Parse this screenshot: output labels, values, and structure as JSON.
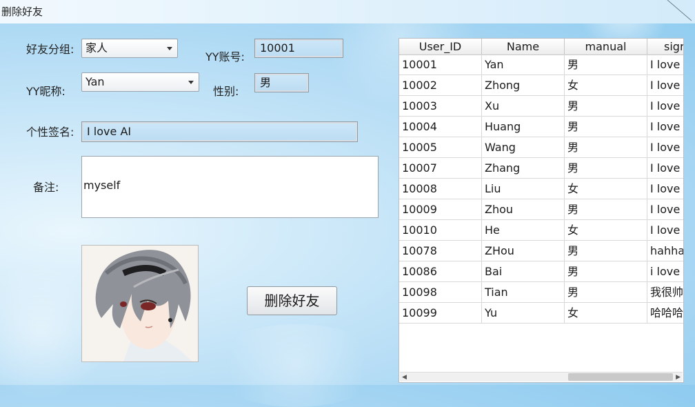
{
  "window": {
    "title": "删除好友"
  },
  "form": {
    "group_label": "好友分组:",
    "group_value": "家人",
    "account_label": "YY账号:",
    "account_value": "10001",
    "nickname_label": "YY昵称:",
    "nickname_value": "Yan",
    "gender_label": "性别:",
    "gender_value": "男",
    "signature_label": "个性签名:",
    "signature_value": "I love AI",
    "remark_label": "备注:",
    "remark_value": "myself"
  },
  "actions": {
    "delete_label": "删除好友"
  },
  "table": {
    "columns": [
      "User_ID",
      "Name",
      "manual",
      "sigr"
    ],
    "rows": [
      [
        "10001",
        "Yan",
        "男",
        "I love A"
      ],
      [
        "10002",
        "Zhong",
        "女",
        "I love n"
      ],
      [
        "10003",
        "Xu",
        "男",
        "I love ."
      ],
      [
        "10004",
        "Huang",
        "男",
        "I love n"
      ],
      [
        "10005",
        "Wang",
        "男",
        "I love p"
      ],
      [
        "10007",
        "Zhang",
        "男",
        "I love e"
      ],
      [
        "10008",
        "Liu",
        "女",
        "I love c"
      ],
      [
        "10009",
        "Zhou",
        "男",
        "I love c"
      ],
      [
        "10010",
        "He",
        "女",
        "I love f"
      ],
      [
        "10078",
        "ZHou",
        "男",
        "hahha"
      ],
      [
        "10086",
        "Bai",
        "男",
        "i love f"
      ],
      [
        "10098",
        "Tian",
        "男",
        "我很帅"
      ],
      [
        "10099",
        "Yu",
        "女",
        "哈哈哈"
      ]
    ]
  },
  "icons": {
    "dropdown": "chevron-down-icon",
    "avatar": "anime-avatar-image"
  }
}
